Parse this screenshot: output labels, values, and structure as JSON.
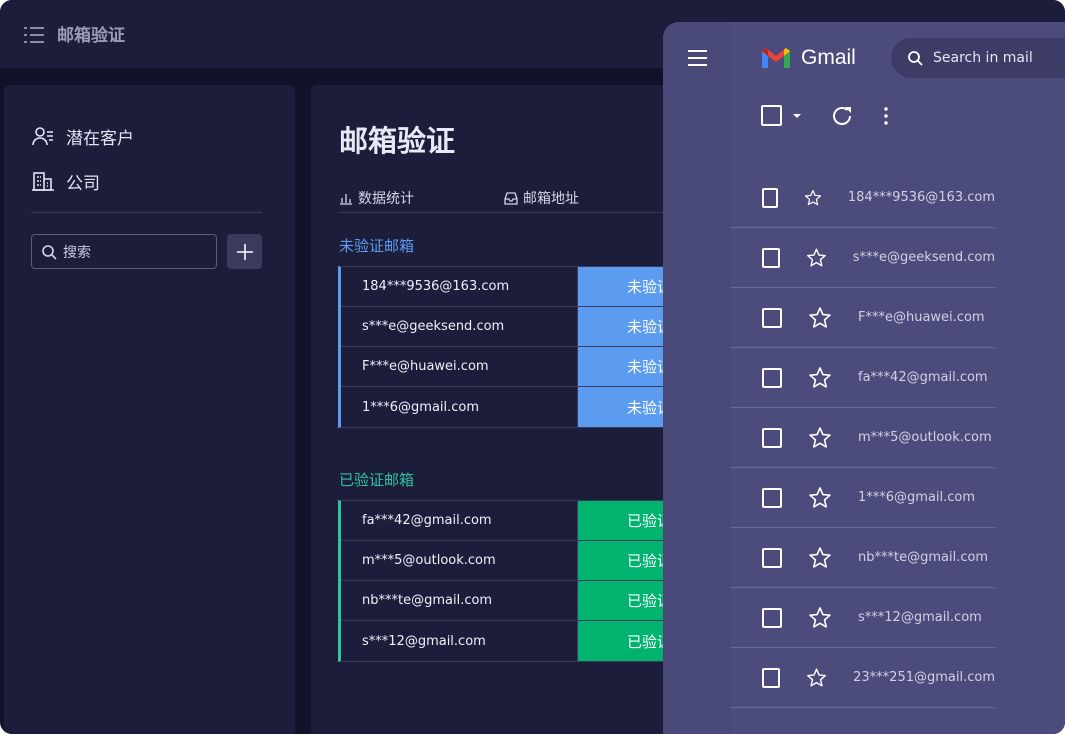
{
  "topbar": {
    "title": "邮箱验证"
  },
  "sidebar": {
    "items": [
      {
        "label": "潜在客户",
        "icon": "contacts-icon"
      },
      {
        "label": "公司",
        "icon": "building-icon"
      }
    ],
    "search_placeholder": "搜索"
  },
  "main": {
    "title": "邮箱验证",
    "tabs": [
      {
        "label": "数据统计",
        "icon": "bar-chart-icon"
      },
      {
        "label": "邮箱地址",
        "icon": "inbox-icon"
      }
    ],
    "unverified": {
      "title": "未验证邮箱",
      "rows": [
        {
          "email": "184***9536@163.com",
          "status": "未验证"
        },
        {
          "email": "s***e@geeksend.com",
          "status": "未验证"
        },
        {
          "email": "F***e@huawei.com",
          "status": "未验证"
        },
        {
          "email": "1***6@gmail.com",
          "status": "未验证"
        }
      ]
    },
    "verified": {
      "title": "已验证邮箱",
      "rows": [
        {
          "email": "fa***42@gmail.com",
          "status": "已验证"
        },
        {
          "email": "m***5@outlook.com",
          "status": "已验证"
        },
        {
          "email": "nb***te@gmail.com",
          "status": "已验证"
        },
        {
          "email": "s***12@gmail.com",
          "status": "已验证"
        }
      ]
    }
  },
  "gmail": {
    "brand": "Gmail",
    "search_placeholder": "Search in mail",
    "rows": [
      "184***9536@163.com",
      "s***e@geeksend.com",
      "F***e@huawei.com",
      "fa***42@gmail.com",
      "m***5@outlook.com",
      "1***6@gmail.com",
      "nb***te@gmail.com",
      "s***12@gmail.com",
      "23***251@gmail.com"
    ]
  },
  "colors": {
    "unverified": "#5b9cf0",
    "verified": "#00b36e",
    "verified_title": "#2ec4a0",
    "panel_bg": "#1c1d3a",
    "gmail_bg": "#4c4c7c"
  }
}
